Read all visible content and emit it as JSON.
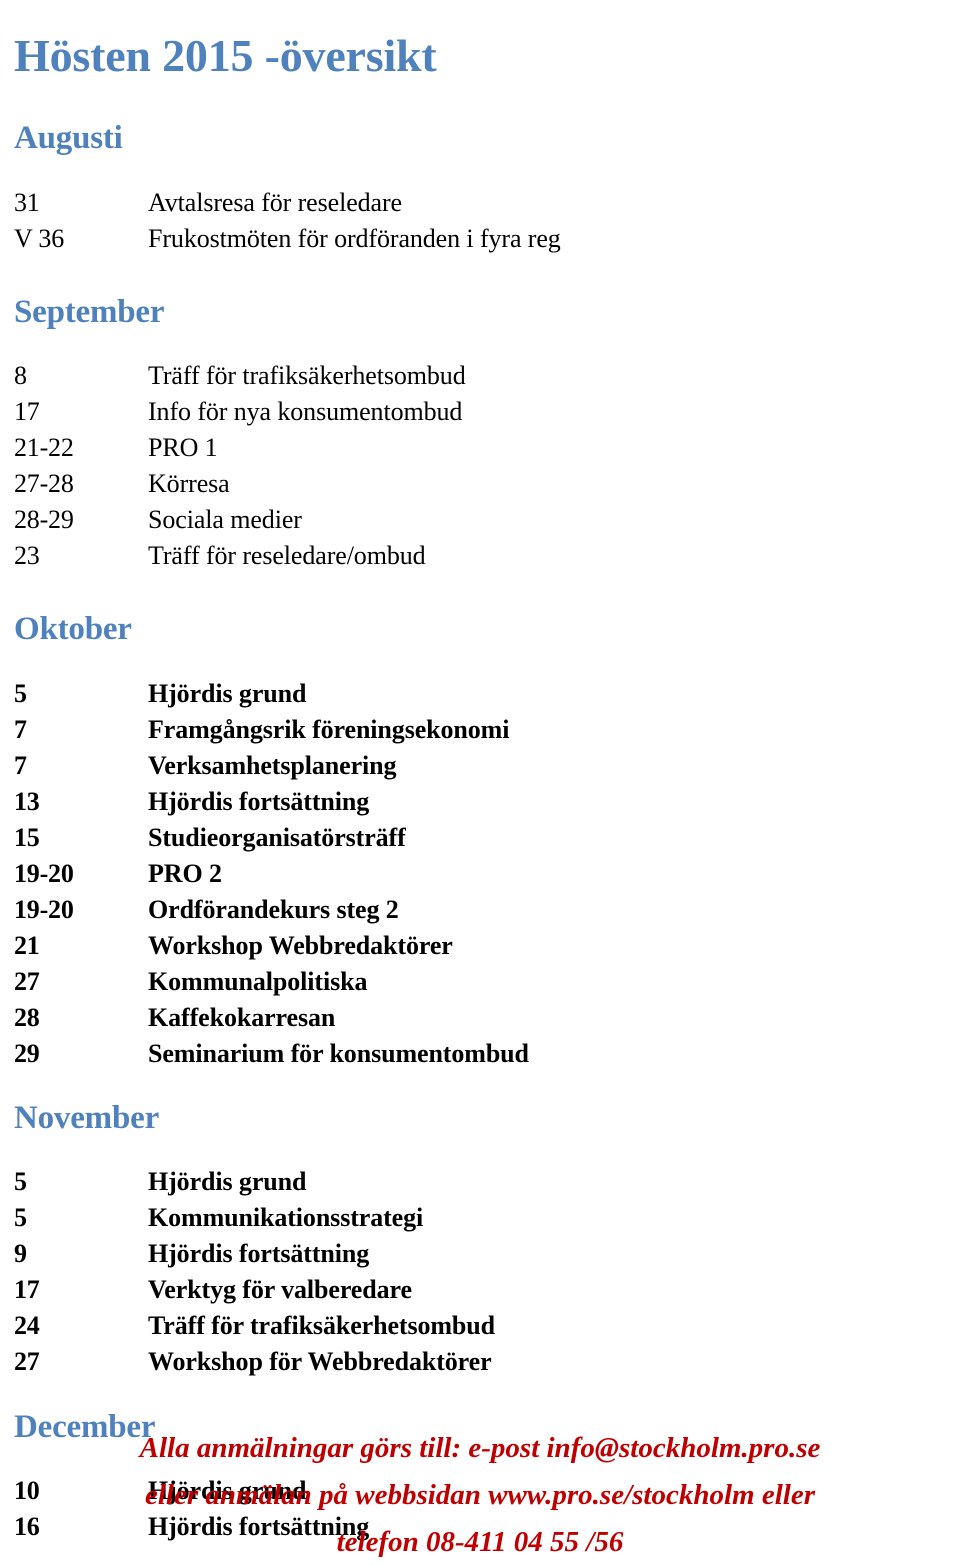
{
  "document": {
    "title": "Hösten 2015 -översikt",
    "accent_color": "#4f81bd",
    "footer_color": "#c00000",
    "text_color": "#000000",
    "background_color": "#ffffff"
  },
  "months": [
    {
      "name": "Augusti",
      "events": [
        {
          "date": "31",
          "label": "Avtalsresa för reseledare"
        },
        {
          "date": "V 36",
          "label": "Frukostmöten för ordföranden i fyra reg"
        }
      ]
    },
    {
      "name": "September",
      "events": [
        {
          "date": "8",
          "label": "Träff för trafiksäkerhetsombud"
        },
        {
          "date": "17",
          "label": "Info för nya konsumentombud"
        },
        {
          "date": "21-22",
          "label": "PRO 1"
        },
        {
          "date": "27-28",
          "label": "Körresa"
        },
        {
          "date": "28-29",
          "label": "Sociala medier"
        },
        {
          "date": "23",
          "label": "Träff för reseledare/ombud"
        }
      ]
    },
    {
      "name": "Oktober",
      "events": [
        {
          "date": "5",
          "label": "Hjördis grund"
        },
        {
          "date": "7",
          "label": "Framgångsrik föreningsekonomi"
        },
        {
          "date": "7",
          "label": "Verksamhetsplanering"
        },
        {
          "date": "13",
          "label": "Hjördis fortsättning"
        },
        {
          "date": "15",
          "label": "Studieorganisatörsträff"
        },
        {
          "date": "19-20",
          "label": "PRO 2"
        },
        {
          "date": "19-20",
          "label": "Ordförandekurs steg 2"
        },
        {
          "date": "21",
          "label": "Workshop Webbredaktörer"
        },
        {
          "date": "27",
          "label": "Kommunalpolitiska"
        },
        {
          "date": "28",
          "label": "Kaffekokarresan"
        },
        {
          "date": "29",
          "label": "Seminarium för konsumentombud"
        }
      ]
    },
    {
      "name": "November",
      "events": [
        {
          "date": "5",
          "label": "Hjördis grund"
        },
        {
          "date": "5",
          "label": "Kommunikationsstrategi"
        },
        {
          "date": "9",
          "label": "Hjördis fortsättning"
        },
        {
          "date": "17",
          "label": "Verktyg för valberedare"
        },
        {
          "date": "24",
          "label": "Träff för trafiksäkerhetsombud"
        },
        {
          "date": "27",
          "label": "Workshop för Webbredaktörer"
        }
      ]
    },
    {
      "name": "December",
      "events": [
        {
          "date": "10",
          "label": "Hjördis grund"
        },
        {
          "date": "16",
          "label": "Hjördis fortsättning"
        }
      ]
    }
  ],
  "footer": {
    "lines": [
      "Alla anmälningar görs till: e-post info@stockholm.pro.se",
      "eller anmälan på webbsidan www.pro.se/stockholm eller",
      "telefon 08-411 04 55 /56"
    ]
  }
}
